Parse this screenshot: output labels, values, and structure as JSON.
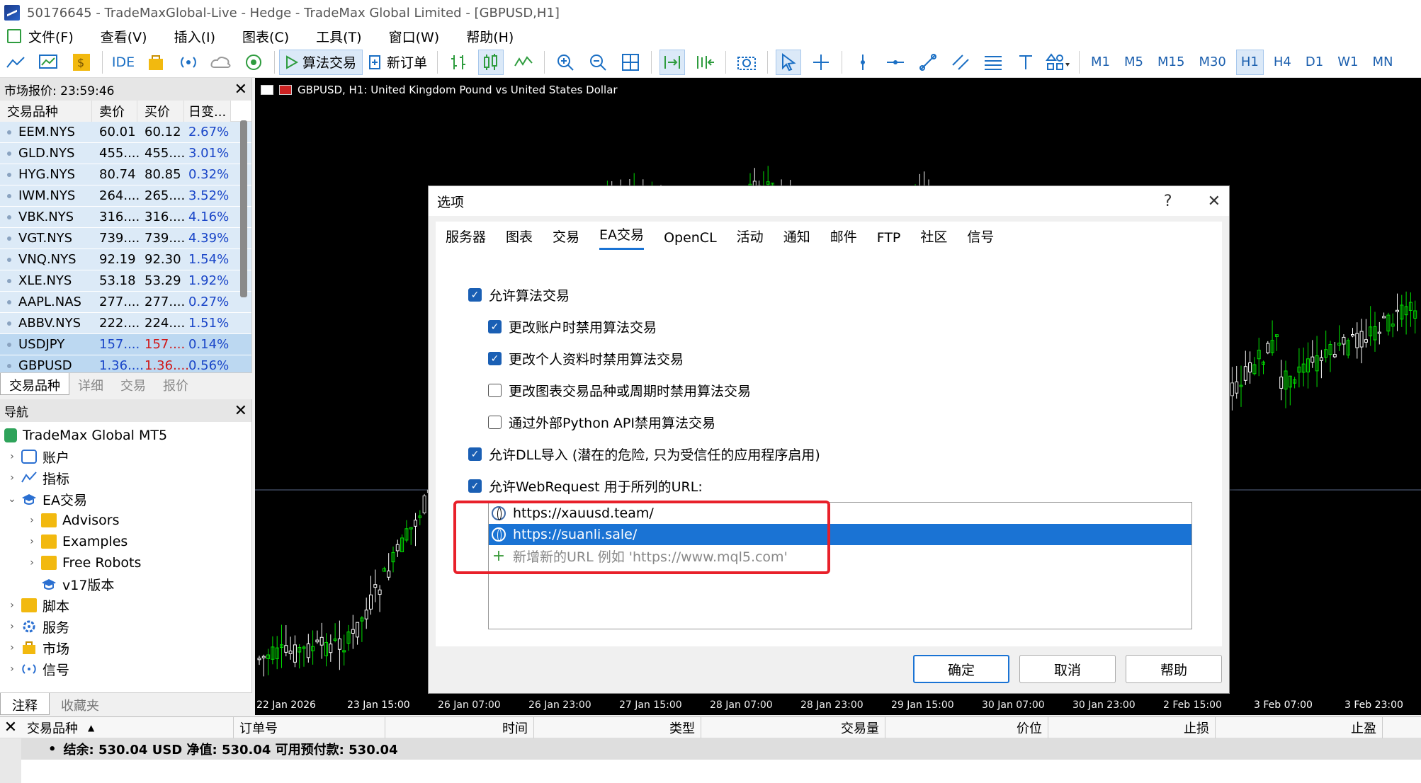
{
  "window": {
    "title": "50176645 - TradeMaxGlobal-Live - Hedge - TradeMax Global Limited - [GBPUSD,H1]"
  },
  "menu": [
    "文件(F)",
    "查看(V)",
    "插入(I)",
    "图表(C)",
    "工具(T)",
    "窗口(W)",
    "帮助(H)"
  ],
  "toolbar": {
    "ide": "IDE",
    "algo_trading": "算法交易",
    "new_order": "新订单",
    "timeframes": [
      "M1",
      "M5",
      "M15",
      "M30",
      "H1",
      "H4",
      "D1",
      "W1",
      "MN"
    ],
    "active_timeframe": "H1"
  },
  "market_watch": {
    "title": "市场报价: 23:59:46",
    "headers": [
      "交易品种",
      "卖价",
      "买价",
      "日变..."
    ],
    "rows": [
      {
        "symbol": "EEM.NYS",
        "bid": "60.01",
        "ask": "60.12",
        "change": "2.67%"
      },
      {
        "symbol": "GLD.NYS",
        "bid": "455....",
        "ask": "455....",
        "change": "3.01%"
      },
      {
        "symbol": "HYG.NYS",
        "bid": "80.74",
        "ask": "80.85",
        "change": "0.32%"
      },
      {
        "symbol": "IWM.NYS",
        "bid": "264....",
        "ask": "265....",
        "change": "3.52%"
      },
      {
        "symbol": "VBK.NYS",
        "bid": "316....",
        "ask": "316....",
        "change": "4.16%"
      },
      {
        "symbol": "VGT.NYS",
        "bid": "739....",
        "ask": "739....",
        "change": "4.39%"
      },
      {
        "symbol": "VNQ.NYS",
        "bid": "92.19",
        "ask": "92.30",
        "change": "1.54%"
      },
      {
        "symbol": "XLE.NYS",
        "bid": "53.18",
        "ask": "53.29",
        "change": "1.92%"
      },
      {
        "symbol": "AAPL.NAS",
        "bid": "277....",
        "ask": "277....",
        "change": "0.27%"
      },
      {
        "symbol": "ABBV.NYS",
        "bid": "222....",
        "ask": "224....",
        "change": "1.51%"
      },
      {
        "symbol": "USDJPY",
        "bid": "157....",
        "ask": "157....",
        "change": "0.14%"
      },
      {
        "symbol": "GBPUSD",
        "bid": "1.36....",
        "ask": "1.36....",
        "change": "0.56%"
      }
    ],
    "tabs": [
      "交易品种",
      "详细",
      "交易",
      "报价"
    ]
  },
  "navigator": {
    "title": "导航",
    "root": "TradeMax Global MT5",
    "items": [
      "账户",
      "指标",
      "EA交易",
      "Advisors",
      "Examples",
      "Free Robots",
      "v17版本",
      "脚本",
      "服务",
      "市场",
      "信号"
    ],
    "tabs": [
      "注释",
      "收藏夹"
    ]
  },
  "chart": {
    "title": "GBPUSD, H1:  United Kingdom Pound vs United States Dollar",
    "time_labels": [
      "22 Jan 2026",
      "23 Jan 15:00",
      "26 Jan 07:00",
      "26 Jan 23:00",
      "27 Jan 15:00",
      "28 Jan 07:00",
      "28 Jan 23:00",
      "29 Jan 15:00",
      "30 Jan 07:00",
      "30 Jan 23:00",
      "2 Feb 15:00",
      "3 Feb 07:00",
      "3 Feb 23:00"
    ],
    "up_color": "#00e000",
    "down_color": "#ffffff"
  },
  "dialog": {
    "title": "选项",
    "help": "?",
    "close": "✕",
    "tabs": [
      "服务器",
      "图表",
      "交易",
      "EA交易",
      "OpenCL",
      "活动",
      "通知",
      "邮件",
      "FTP",
      "社区",
      "信号"
    ],
    "active_tab": "EA交易",
    "options": [
      {
        "label": "允许算法交易",
        "checked": true
      },
      {
        "label": "更改账户时禁用算法交易",
        "checked": true
      },
      {
        "label": "更改个人资料时禁用算法交易",
        "checked": true
      },
      {
        "label": "更改图表交易品种或周期时禁用算法交易",
        "checked": false
      },
      {
        "label": "通过外部Python API禁用算法交易",
        "checked": false
      },
      {
        "label": "允许DLL导入 (潜在的危险, 只为受信任的应用程序启用)",
        "checked": true
      },
      {
        "label": "允许WebRequest 用于所列的URL:",
        "checked": true
      }
    ],
    "urls": [
      "https://xauusd.team/",
      "https://suanli.sale/"
    ],
    "add_url_hint": "新增新的URL 例如 'https://www.mql5.com'",
    "buttons": {
      "ok": "确定",
      "cancel": "取消",
      "help": "帮助"
    }
  },
  "toolbox": {
    "headers": [
      "交易品种",
      "订单号",
      "时间",
      "类型",
      "交易量",
      "价位",
      "止损",
      "止盈"
    ],
    "balance": "结余: 530.04 USD  净值: 530.04  可用预付款: 530.04"
  }
}
